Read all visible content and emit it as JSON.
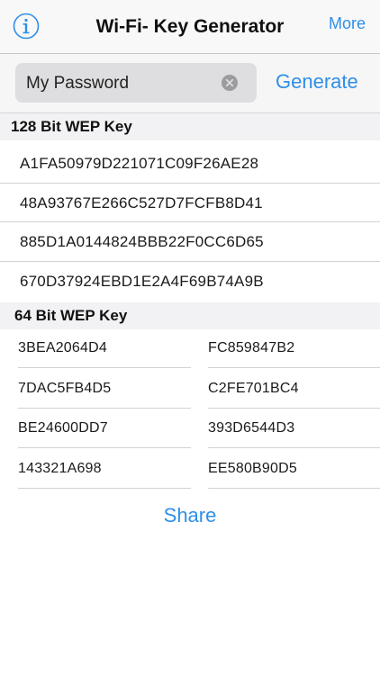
{
  "navbar": {
    "title": "Wi-Fi- Key Generator",
    "more_label": "More",
    "info_icon": "info-circle-icon"
  },
  "password": {
    "value": "My Password",
    "clear_icon": "clear-circle-icon"
  },
  "generate_label": "Generate",
  "wep128": {
    "header": "128 Bit WEP Key",
    "keys": [
      "A1FA50979D221071C09F26AE28",
      "48A93767E266C527D7FCFB8D41",
      "885D1A0144824BBB22F0CC6D65",
      "670D37924EBD1E2A4F69B74A9B"
    ]
  },
  "wep64": {
    "header": "64 Bit WEP Key",
    "keys": [
      [
        "3BEA2064D4",
        "FC859847B2"
      ],
      [
        "7DAC5FB4D5",
        "C2FE701BC4"
      ],
      [
        "BE24600DD7",
        "393D6544D3"
      ],
      [
        "143321A698",
        "EE580B90D5"
      ]
    ]
  },
  "share_label": "Share",
  "colors": {
    "accent": "#2f8fe8",
    "header_bg": "#f2f2f4",
    "field_bg": "#dedee0"
  }
}
